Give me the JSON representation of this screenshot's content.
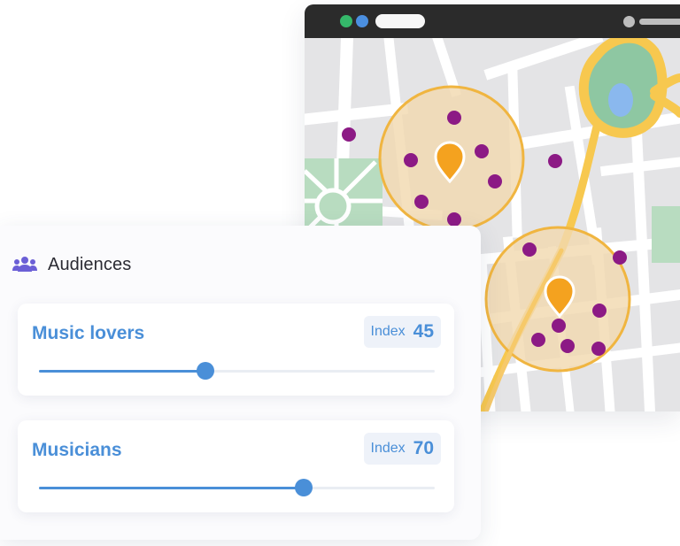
{
  "map": {
    "colors": {
      "base": "#e4e4e6",
      "road": "#ffffff",
      "park": "#b8dcc0",
      "water": "#8ab8ee",
      "highway": "#f7c84f",
      "radius_fill": "#f2d9b0",
      "radius_stroke": "#f0b540",
      "pin": "#f4a21f",
      "audience_dot": "#8c1a85"
    },
    "icons": [
      "location-pin-icon",
      "location-pin-icon"
    ]
  },
  "audiences": {
    "title": "Audiences",
    "icon": "people-group-icon",
    "items": [
      {
        "name": "Music lovers",
        "index_label": "Index",
        "index_value": "45",
        "level": 0.42
      },
      {
        "name": "Musicians",
        "index_label": "Index",
        "index_value": "70",
        "level": 0.67
      }
    ]
  },
  "accent_color": "#4a8fd8"
}
